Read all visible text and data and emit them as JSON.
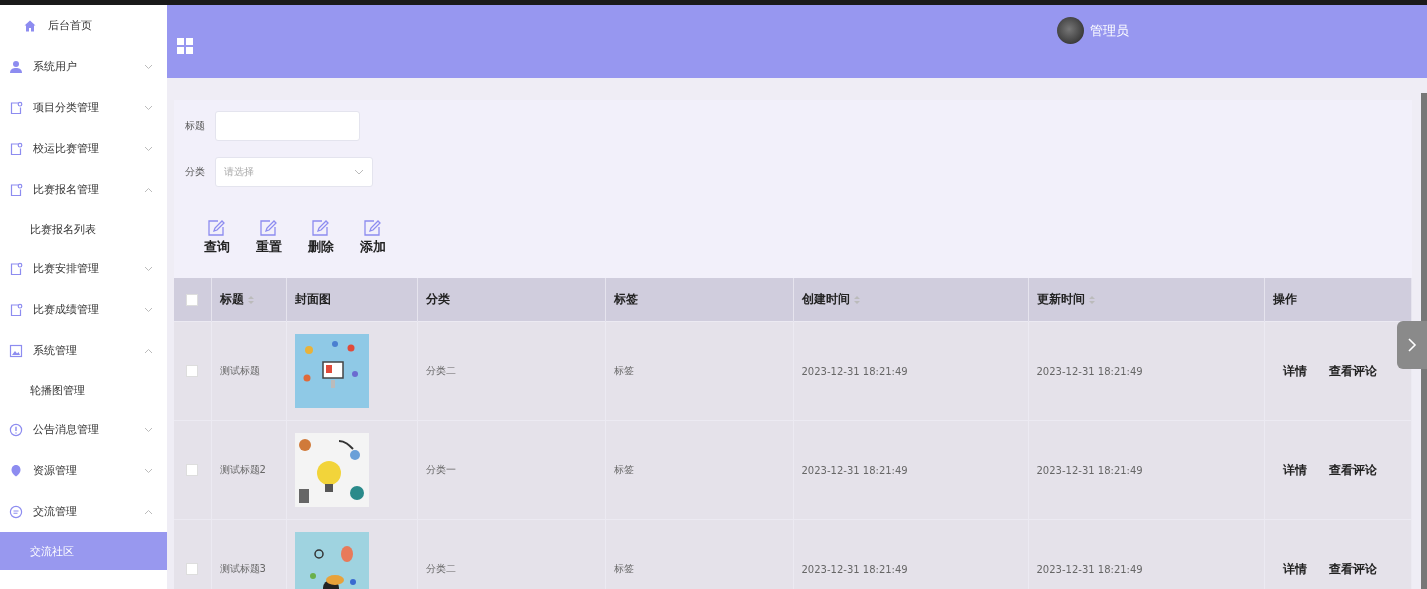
{
  "sidebar": {
    "items": [
      {
        "kind": "home",
        "label": "后台首页"
      },
      {
        "kind": "group",
        "label": "系统用户",
        "expanded": false
      },
      {
        "kind": "group",
        "label": "项目分类管理",
        "expanded": false
      },
      {
        "kind": "group",
        "label": "校运比赛管理",
        "expanded": false
      },
      {
        "kind": "group",
        "label": "比赛报名管理",
        "expanded": true,
        "children": [
          {
            "label": "比赛报名列表",
            "selected": false
          }
        ]
      },
      {
        "kind": "group",
        "label": "比赛安排管理",
        "expanded": false
      },
      {
        "kind": "group",
        "label": "比赛成绩管理",
        "expanded": false
      },
      {
        "kind": "group",
        "label": "系统管理",
        "expanded": true,
        "children": [
          {
            "label": "轮播图管理",
            "selected": false
          }
        ]
      },
      {
        "kind": "group",
        "label": "公告消息管理",
        "expanded": false
      },
      {
        "kind": "group",
        "label": "资源管理",
        "expanded": false
      },
      {
        "kind": "group",
        "label": "交流管理",
        "expanded": true,
        "children": [
          {
            "label": "交流社区",
            "selected": true
          }
        ]
      }
    ]
  },
  "header": {
    "user": "管理员"
  },
  "filters": [
    {
      "kind": "input",
      "label": "标题"
    },
    {
      "kind": "select",
      "label": "分类",
      "placeholder": "请选择"
    }
  ],
  "actions": [
    "查询",
    "重置",
    "删除",
    "添加"
  ],
  "table": {
    "all_checked": false,
    "columns": [
      {
        "label": "标题",
        "sortable": true
      },
      {
        "label": "封面图",
        "sortable": false
      },
      {
        "label": "分类",
        "sortable": false
      },
      {
        "label": "标签",
        "sortable": false
      },
      {
        "label": "创建时间",
        "sortable": true
      },
      {
        "label": "更新时间",
        "sortable": true
      },
      {
        "label": "操作",
        "sortable": false
      }
    ],
    "rows": [
      {
        "checked": false,
        "title": "测试标题",
        "cover": {
          "kind": "picture"
        },
        "category": "分类二",
        "tag": "标签",
        "created": "2023-12-31 18:21:49",
        "updated": "2023-12-31 18:21:49",
        "actions": [
          "详情",
          "查看评论"
        ]
      },
      {
        "checked": false,
        "title": "测试标题2",
        "cover": {
          "kind": "picture"
        },
        "category": "分类一",
        "tag": "标签",
        "created": "2023-12-31 18:21:49",
        "updated": "2023-12-31 18:21:49",
        "actions": [
          "详情",
          "查看评论"
        ]
      },
      {
        "checked": false,
        "title": "测试标题3",
        "cover": {
          "kind": "picture"
        },
        "category": "分类二",
        "tag": "标签",
        "created": "2023-12-31 18:21:49",
        "updated": "2023-12-31 18:21:49",
        "actions": [
          "详情",
          "查看评论"
        ]
      }
    ]
  }
}
